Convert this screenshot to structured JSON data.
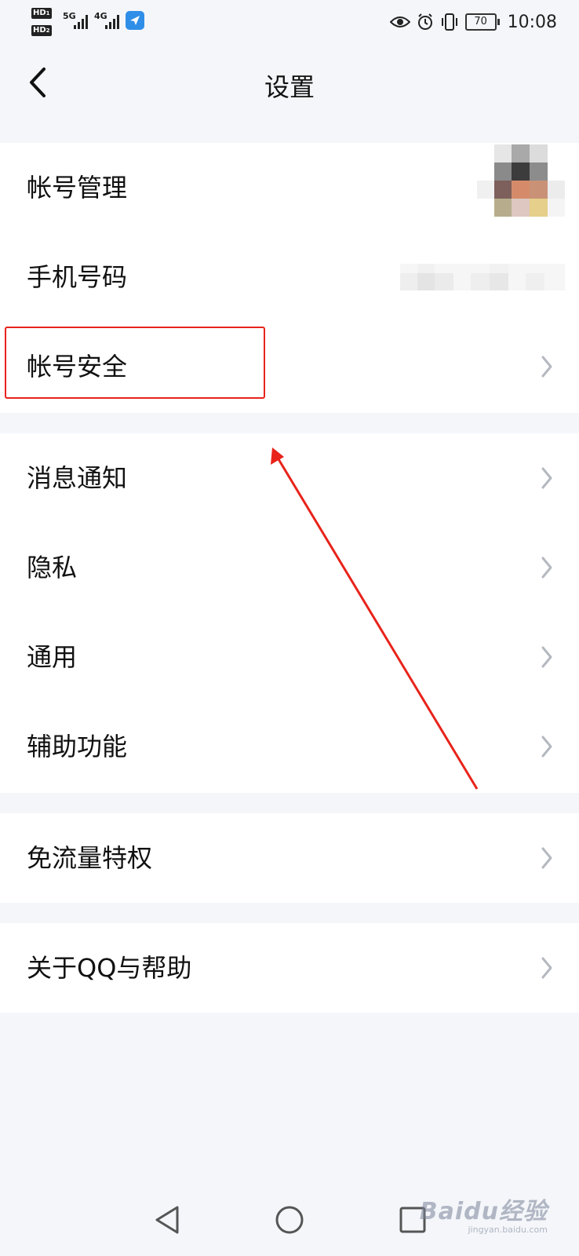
{
  "status_bar": {
    "hd1": "HD",
    "hd2": "HD",
    "net1": "5G",
    "net2": "4G",
    "battery_level": "70",
    "time": "10:08"
  },
  "header": {
    "title": "设置"
  },
  "settings": {
    "account_management": "帐号管理",
    "phone_number": "手机号码",
    "account_security": "帐号安全",
    "notifications": "消息通知",
    "privacy": "隐私",
    "general": "通用",
    "accessibility": "辅助功能",
    "free_data": "免流量特权",
    "about_help": "关于QQ与帮助"
  },
  "annotation": {
    "box_color": "#e8231a",
    "arrow_color": "#e8231a"
  },
  "watermark": {
    "logo": "Baidu经验",
    "url": "jingyan.baidu.com"
  },
  "icons": {
    "back": "chevron-left-icon",
    "row_arrow": "chevron-right-icon",
    "eye": "eye-icon",
    "alarm": "alarm-icon",
    "vibrate": "vibrate-icon"
  }
}
